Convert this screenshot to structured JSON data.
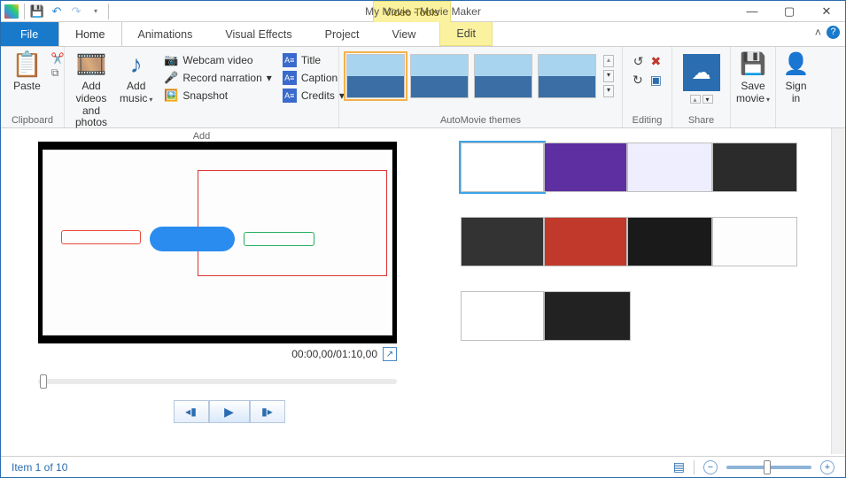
{
  "title": "My Movie - Movie Maker",
  "context_tab": "Video Tools",
  "tabs": {
    "file": "File",
    "home": "Home",
    "animations": "Animations",
    "vfx": "Visual Effects",
    "project": "Project",
    "view": "View",
    "edit": "Edit"
  },
  "ribbon": {
    "clipboard": {
      "label": "Clipboard",
      "paste": "Paste"
    },
    "add": {
      "label": "Add",
      "add_videos_line1": "Add videos",
      "add_videos_line2": "and photos",
      "add_music_line1": "Add",
      "add_music_line2": "music",
      "webcam": "Webcam video",
      "record": "Record narration",
      "snapshot": "Snapshot",
      "title": "Title",
      "caption": "Caption",
      "credits": "Credits"
    },
    "automovie": {
      "label": "AutoMovie themes"
    },
    "editing": {
      "label": "Editing"
    },
    "share": {
      "label": "Share"
    },
    "save_line1": "Save",
    "save_line2": "movie",
    "signin_line1": "Sign",
    "signin_line2": "in"
  },
  "playback": {
    "time": "00:00,00/01:10,00"
  },
  "status": {
    "item_text": "Item 1 of 10"
  }
}
